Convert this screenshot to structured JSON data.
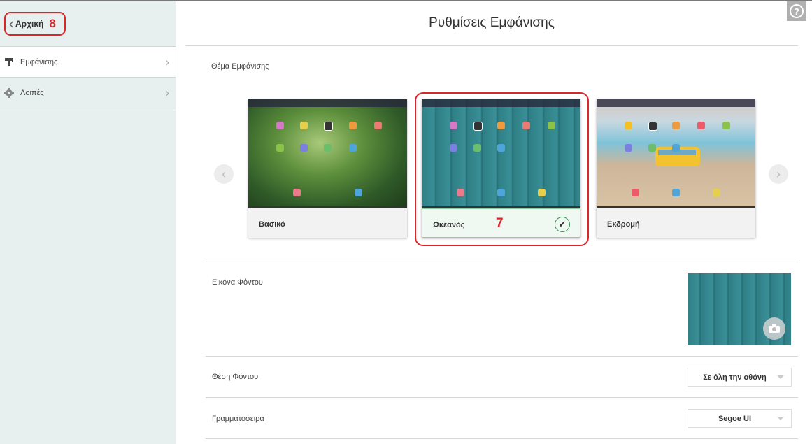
{
  "nav": {
    "home_label": "Αρχική",
    "home_annotation": "8"
  },
  "sidebar": {
    "items": [
      {
        "label": "Εμφάνισης",
        "icon": "paint-roller-icon",
        "active": true
      },
      {
        "label": "Λοιπές",
        "icon": "gear-icon",
        "active": false
      }
    ]
  },
  "header": {
    "title": "Ρυθμίσεις Εμφάνισης",
    "help_icon": "?"
  },
  "theme": {
    "label": "Θέμα Εμφάνισης",
    "cards": [
      {
        "name": "Βασικό",
        "selected": false
      },
      {
        "name": "Ωκεανός",
        "selected": true
      },
      {
        "name": "Εκδρομή",
        "selected": false
      }
    ],
    "annotation": "7",
    "check_glyph": "✔"
  },
  "background_image": {
    "label": "Εικόνα Φόντου"
  },
  "background_position": {
    "label": "Θέση Φόντου",
    "value": "Σε όλη την οθόνη"
  },
  "font": {
    "label": "Γραμματοσειρά",
    "value": "Segoe UI"
  },
  "colors": {
    "accent_red": "#d8262b",
    "sidebar_bg": "#e8f0ef",
    "ocean": "#2f7f86",
    "selected_green": "#8ccf9c"
  }
}
